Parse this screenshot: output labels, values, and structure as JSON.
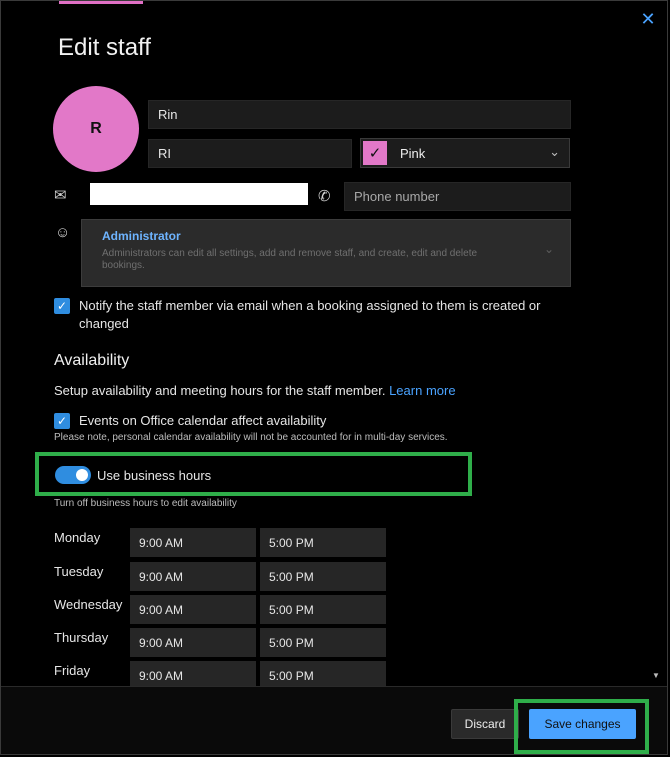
{
  "dialog": {
    "title": "Edit staff",
    "close_glyph": "✕"
  },
  "staff": {
    "avatar_initial": "R",
    "display_name": "Rin",
    "initials": "RI",
    "color_label": "Pink",
    "color_hex": "#e278c8",
    "email_value": "",
    "phone_placeholder": "Phone number"
  },
  "role": {
    "name": "Administrator",
    "description": "Administrators can edit all settings, add and remove staff, and create, edit and delete bookings."
  },
  "notify": {
    "checked": true,
    "label": "Notify the staff member via email when a booking assigned to them is created or changed"
  },
  "availability": {
    "title": "Availability",
    "description": "Setup availability and meeting hours for the staff member.",
    "learn_more": "Learn more",
    "office_calendar_label": "Events on Office calendar affect availability",
    "office_calendar_note": "Please note, personal calendar availability will not be accounted for in multi-day services.",
    "business_hours_label": "Use business hours",
    "business_hours_on": true,
    "business_hours_note": "Turn off business hours to edit availability"
  },
  "schedule": [
    {
      "day": "Monday",
      "start": "9:00 AM",
      "end": "5:00 PM"
    },
    {
      "day": "Tuesday",
      "start": "9:00 AM",
      "end": "5:00 PM"
    },
    {
      "day": "Wednesday",
      "start": "9:00 AM",
      "end": "5:00 PM"
    },
    {
      "day": "Thursday",
      "start": "9:00 AM",
      "end": "5:00 PM"
    },
    {
      "day": "Friday",
      "start": "9:00 AM",
      "end": "5:00 PM"
    }
  ],
  "footer": {
    "discard_label": "Discard",
    "save_label": "Save changes"
  },
  "colors": {
    "accent": "#4aa3ff",
    "highlight": "#2fae4a",
    "avatar": "#e278c8"
  }
}
